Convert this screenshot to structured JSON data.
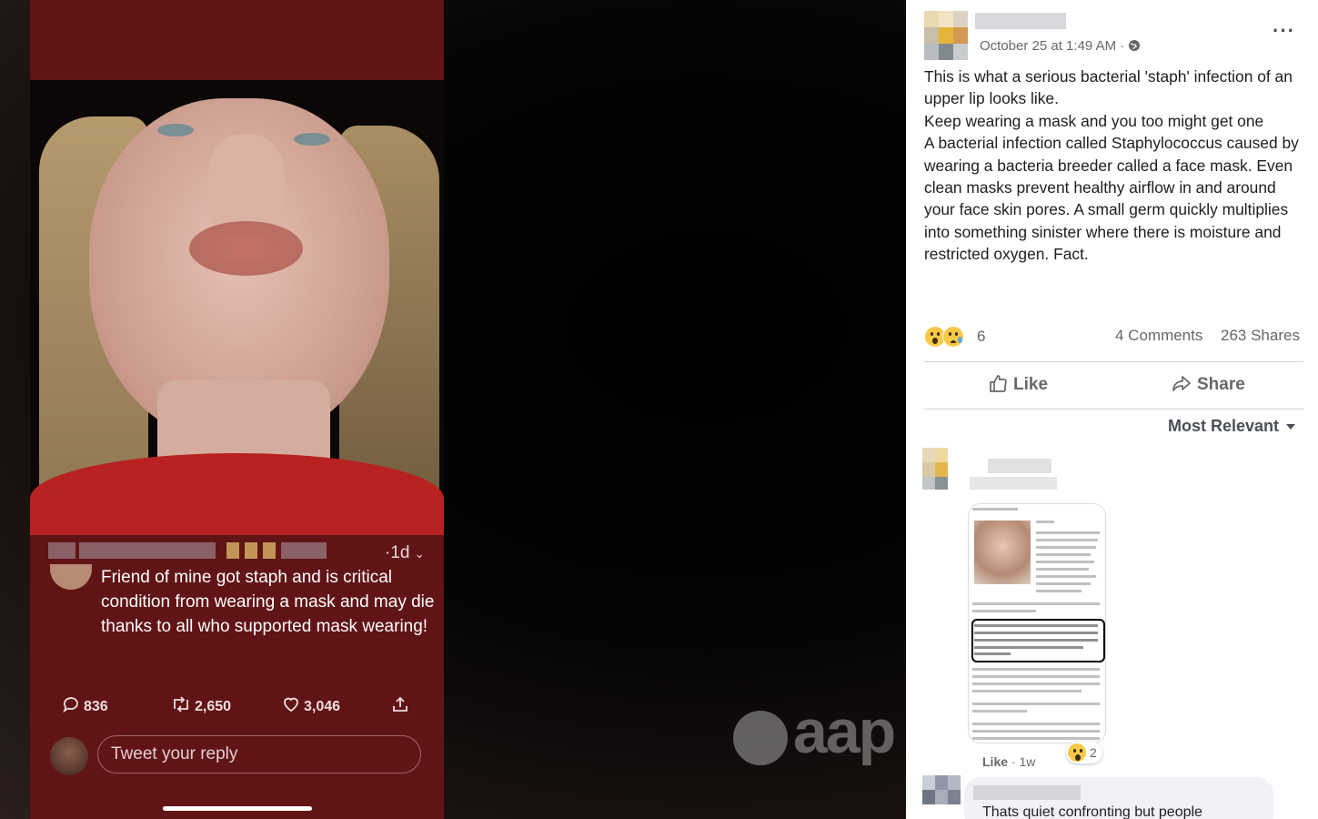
{
  "viewer": {
    "tweet": {
      "time": "·1d",
      "text": "Friend of mine got staph and is critical condition from wearing a mask and may die thanks to all who supported mask wearing!",
      "replies": "836",
      "retweets": "2,650",
      "likes": "3,046",
      "reply_placeholder": "Tweet your reply"
    },
    "watermark": "aap"
  },
  "post": {
    "timestamp": "October 25 at 1:49 AM ·",
    "more_label": "···",
    "body": [
      "This is what a serious bacterial 'staph' infection of an upper lip looks like.",
      "Keep wearing a mask and you too might get one",
      "A bacterial infection called Staphylococcus caused by wearing a bacteria breeder called a face mask. Even clean masks prevent healthy airflow in and around your face skin pores. A small germ quickly multiplies into something sinister where there is moisture and restricted oxygen. Fact."
    ],
    "reactions": {
      "icons": [
        "wow-reaction-icon",
        "sad-reaction-icon"
      ],
      "count": "6",
      "comments": "4 Comments",
      "shares": "263 Shares"
    },
    "actions": {
      "like": "Like",
      "share": "Share"
    },
    "sort_label": "Most Relevant",
    "comments": [
      {
        "like_label": "Like",
        "age": " · 1w",
        "reaction_count": "2"
      },
      {
        "text": "Thats quiet confronting but people"
      }
    ]
  },
  "colors": {
    "tweet_bg": "#611416",
    "fb_text": "#1c1e21",
    "fb_meta": "#65676b"
  }
}
